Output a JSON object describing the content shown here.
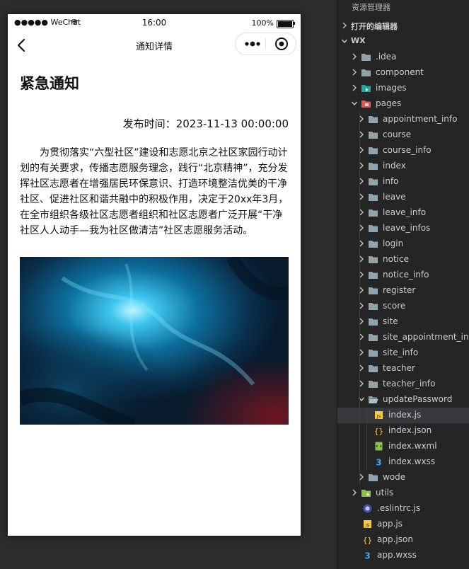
{
  "simulator": {
    "status_bar": {
      "carrier": "●●●●● WeChat",
      "time": "16:00",
      "battery": "100%"
    },
    "nav": {
      "title": "通知详情"
    },
    "notice": {
      "title": "紧急通知",
      "publish_time_label": "发布时间：",
      "publish_time": "2023-11-13 00:00:00",
      "body": "为贯彻落实“六型社区”建设和志愿北京之社区家园行动计划的有关要求，传播志愿服务理念，践行“北京精神”，充分发挥社区志愿者在增强居民环保意识、打造环境整洁优美的干净社区、促进社区和谐共融中的积极作用，决定于20xx年3月，在全市组织各级社区志愿者组织和社区志愿者广泛开展“干净社区人人动手—我为社区做清洁”社区志愿服务活动。"
    }
  },
  "explorer": {
    "title": "资源管理器",
    "open_editors": "打开的编辑器",
    "root": "WX",
    "items": [
      {
        "label": ".idea",
        "icon": "folder"
      },
      {
        "label": "component",
        "icon": "folder"
      },
      {
        "label": "images",
        "icon": "folder-images"
      },
      {
        "label": "pages",
        "icon": "folder-pages"
      },
      {
        "label": "appointment_info",
        "icon": "folder"
      },
      {
        "label": "course",
        "icon": "folder"
      },
      {
        "label": "course_info",
        "icon": "folder"
      },
      {
        "label": "index",
        "icon": "folder"
      },
      {
        "label": "info",
        "icon": "folder"
      },
      {
        "label": "leave",
        "icon": "folder"
      },
      {
        "label": "leave_info",
        "icon": "folder"
      },
      {
        "label": "leave_infos",
        "icon": "folder"
      },
      {
        "label": "login",
        "icon": "folder"
      },
      {
        "label": "notice",
        "icon": "folder"
      },
      {
        "label": "notice_info",
        "icon": "folder"
      },
      {
        "label": "register",
        "icon": "folder"
      },
      {
        "label": "score",
        "icon": "folder"
      },
      {
        "label": "site",
        "icon": "folder"
      },
      {
        "label": "site_appointment_info",
        "icon": "folder"
      },
      {
        "label": "site_info",
        "icon": "folder"
      },
      {
        "label": "teacher",
        "icon": "folder"
      },
      {
        "label": "teacher_info",
        "icon": "folder"
      },
      {
        "label": "updatePassword",
        "icon": "folder-open"
      },
      {
        "label": "index.js",
        "icon": "js-file"
      },
      {
        "label": "index.json",
        "icon": "json-file"
      },
      {
        "label": "index.wxml",
        "icon": "wxml-file"
      },
      {
        "label": "index.wxss",
        "icon": "css-file"
      },
      {
        "label": "wode",
        "icon": "folder"
      },
      {
        "label": "utils",
        "icon": "folder-utils"
      },
      {
        "label": ".eslintrc.js",
        "icon": "eslint-file"
      },
      {
        "label": "app.js",
        "icon": "js-file"
      },
      {
        "label": "app.json",
        "icon": "json-file"
      },
      {
        "label": "app.wxss",
        "icon": "css-file"
      }
    ]
  },
  "colors": {
    "editor_bg": "#2b2b2b",
    "explorer_bg": "#252526",
    "selected_row": "#37373d",
    "folder": "#90a4ae",
    "js": "#f7c948",
    "json": "#f7c948",
    "css": "#42a5f5",
    "wxml": "#8bc34a"
  }
}
